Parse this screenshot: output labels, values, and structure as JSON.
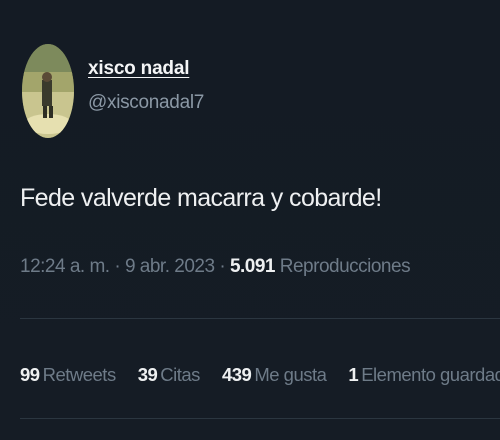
{
  "user": {
    "display_name": "xisco nadal",
    "handle": "@xisconadal7"
  },
  "tweet": {
    "text": "Fede valverde macarra y cobarde!",
    "time": "12:24 a. m.",
    "separator": "·",
    "date": "9 abr. 2023",
    "views_count": "5.091",
    "views_label": "Reproducciones"
  },
  "stats": [
    {
      "count": "99",
      "label": "Retweets"
    },
    {
      "count": "39",
      "label": "Citas"
    },
    {
      "count": "439",
      "label": "Me gusta"
    },
    {
      "count": "1",
      "label": "Elemento guardado"
    }
  ],
  "colors": {
    "background": "#141b24",
    "text": "#eef0f1",
    "muted": "#6e7b88",
    "divider": "#2b3640"
  }
}
